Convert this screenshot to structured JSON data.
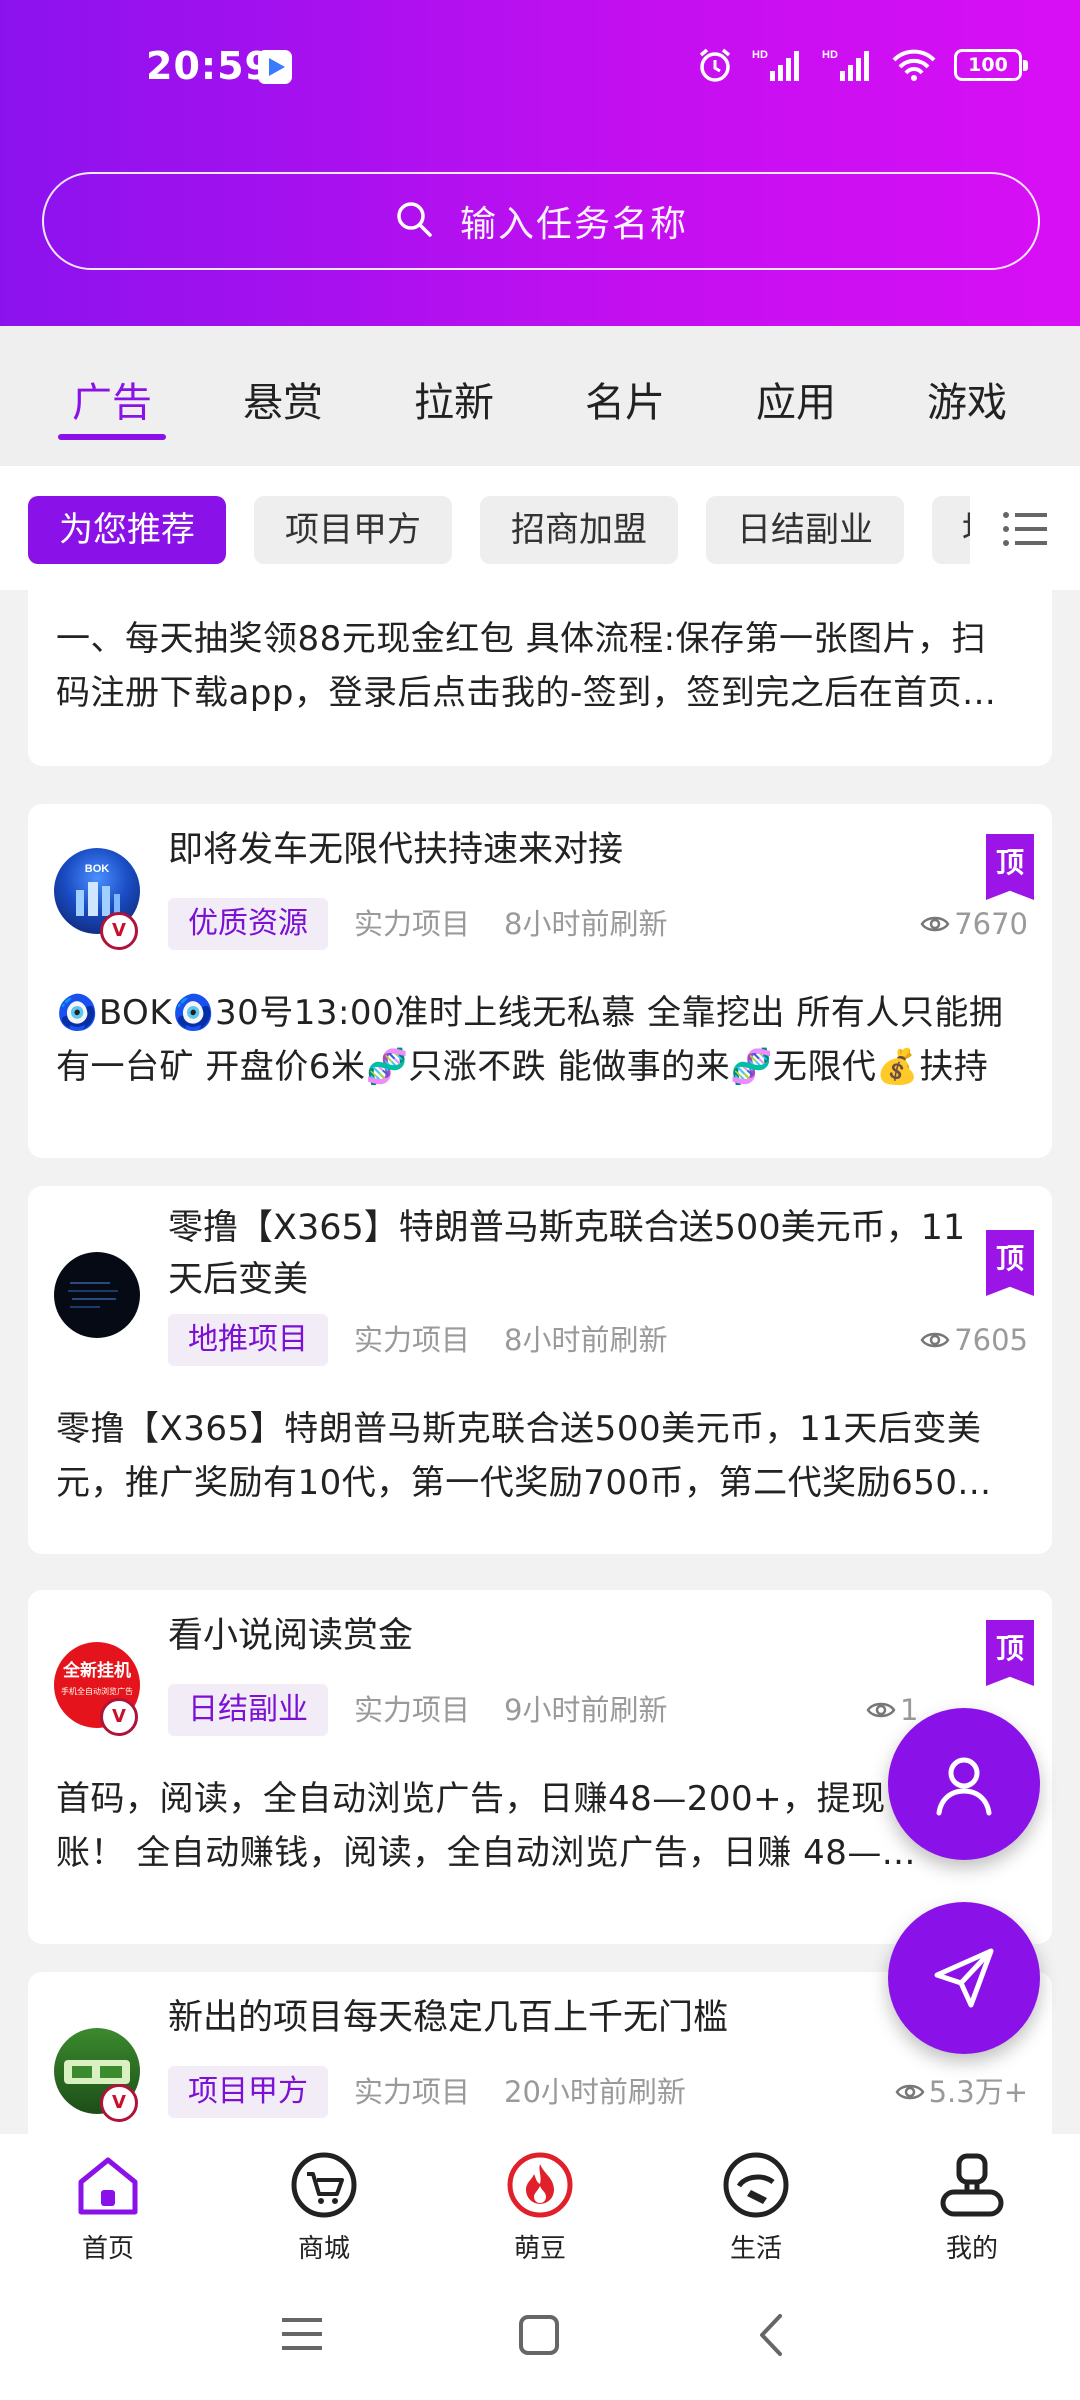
{
  "status": {
    "time": "20:59",
    "battery": "100",
    "net1": "HD",
    "net2": "HD"
  },
  "search": {
    "placeholder": "输入任务名称"
  },
  "tabs": [
    "广告",
    "悬赏",
    "拉新",
    "名片",
    "应用",
    "游戏"
  ],
  "active_tab": "广告",
  "chips": [
    "为您推荐",
    "项目甲方",
    "招商加盟",
    "日结副业",
    "地"
  ],
  "active_chip": "为您推荐",
  "partial_card": {
    "desc_line1": "一、每天抽奖领88元现金红包 具体流程:保存第一张图片，扫",
    "desc_line2": "码注册下载app，登录后点击我的-签到，签到完之后在首页..."
  },
  "cards": [
    {
      "title": "即将发车无限代扶持速来对接",
      "top_label": "顶",
      "tag": "优质资源",
      "category": "实力项目",
      "refresh": "8小时前刷新",
      "views": "7670",
      "desc_line1": "🧿BOK🧿30号13:00准时上线无私慕 全靠挖出 所有人只能拥",
      "desc_line2": "有一台矿 开盘价6米🧬只涨不跌 能做事的来🧬无限代💰扶持"
    },
    {
      "title_line1": "零撸【X365】特朗普马斯克联合送500美元币，11",
      "title_line2": "天后变美",
      "top_label": "顶",
      "tag": "地推项目",
      "category": "实力项目",
      "refresh": "8小时前刷新",
      "views": "7605",
      "desc_line1": "零撸【X365】特朗普马斯克联合送500美元币，11天后变美",
      "desc_line2": "元，推广奖励有10代，第一代奖励700币，第二代奖励650..."
    },
    {
      "title": "看小说阅读赏金",
      "top_label": "顶",
      "tag": "日结副业",
      "category": "实力项目",
      "refresh": "9小时前刷新",
      "views": "1",
      "avatar_text1": "全新挂机",
      "avatar_text2": "手机全自动浏览广告",
      "desc_line1": "首码，阅读，全自动浏览广告，日赚48—200+，提现",
      "desc_line2": "账！ 全自动赚钱，阅读，全自动浏览广告，日赚 48—..."
    },
    {
      "title": "新出的项目每天稳定几百上千无门槛",
      "tag": "项目甲方",
      "category": "实力项目",
      "refresh": "20小时前刷新",
      "views": "5.3万+"
    }
  ],
  "bottom_nav": [
    "首页",
    "商城",
    "萌豆",
    "生活",
    "我的"
  ],
  "active_nav": "首页",
  "colors": {
    "accent": "#8a12e8",
    "header_start": "#8b12ee",
    "header_end": "#d80ff5",
    "hot": "#e0202a"
  }
}
